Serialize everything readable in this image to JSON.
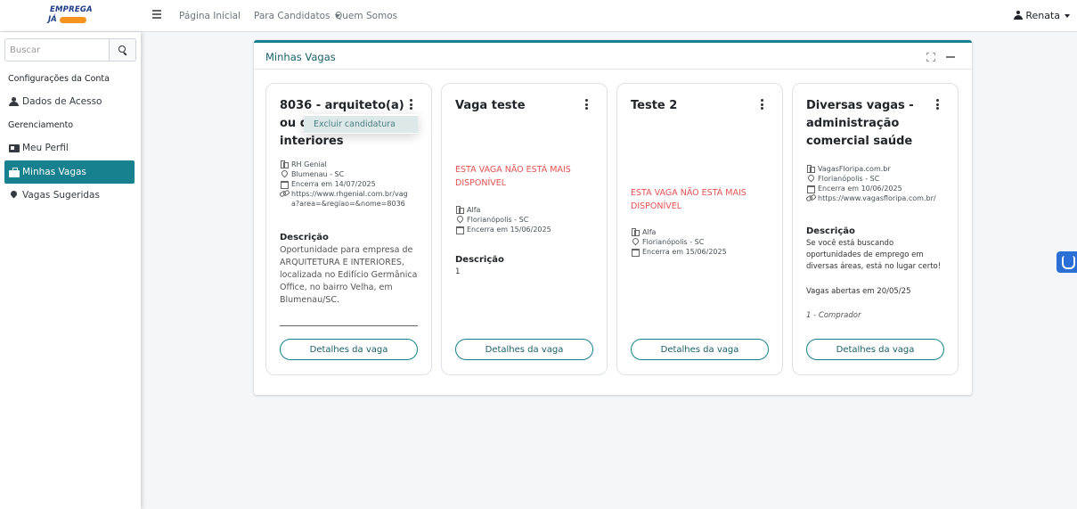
{
  "brand": {
    "line1": "EMPREGA",
    "line2": "JÁ"
  },
  "navbar": {
    "links": [
      "Página Inicial",
      "Para Candidatos",
      "Quem Somos"
    ],
    "user": "Renata"
  },
  "sidebar": {
    "search_placeholder": "Buscar",
    "section1": "Configurações da Conta",
    "item_access": "Dados de Acesso",
    "section2": "Gerenciamento",
    "item_profile": "Meu Perfil",
    "item_jobs": "Minhas Vagas",
    "item_suggested": "Vagas Sugeridas"
  },
  "panel": {
    "title": "Minhas Vagas"
  },
  "dropdown": {
    "item": "Excluir candidatura"
  },
  "cards": [
    {
      "title": "8036 - arquiteto(a) ou de... interiores",
      "title_l1": "8036 - arquiteto(a)",
      "title_l2": "ou de",
      "title_l3": "interiores",
      "company": "RH Genial",
      "location": "Blumenau - SC",
      "ends": "Encerra em 14/07/2025",
      "link": "https://www.rhgenial.com.br/vaga?area=&regiao=&nome=8036",
      "link_l1": "https://www.rhgenial.com.br/vag",
      "link_l2": "a?area=&regiao=&nome=8036",
      "desc_label": "Descrição",
      "desc": "Oportunidade para empresa de ARQUITETURA E INTERIORES, localizada no Edifício Germânica Office, no bairro Velha, em Blumenau/SC.",
      "button": "Detalhes da vaga"
    },
    {
      "title": "Vaga teste",
      "unavailable": "ESTA VAGA NÃO ESTÁ MAIS DISPONÍVEL",
      "company": "Alfa",
      "location": "Florianópolis - SC",
      "ends": "Encerra em 15/06/2025",
      "desc_label": "Descrição",
      "desc": "1",
      "button": "Detalhes da vaga"
    },
    {
      "title": "Teste 2",
      "unavailable": "ESTA VAGA NÃO ESTÁ MAIS DISPONÍVEL",
      "company": "Alfa",
      "location": "Florianópolis - SC",
      "ends": "Encerra em 15/06/2025",
      "button": "Detalhes da vaga"
    },
    {
      "title": "Diversas vagas - administração comercial saúde",
      "company": "VagasFloripa.com.br",
      "location": "Florianópolis - SC",
      "ends": "Encerra em 10/06/2025",
      "link": "https://www.vagasfloripa.com.br/",
      "desc_label": "Descrição",
      "desc": "Se você está buscando oportunidades de emprego em diversas áreas, está no lugar certo!",
      "desc2": "Vagas abertas em 20/05/25",
      "desc3": "1 - Comprador",
      "button": "Detalhes da vaga"
    }
  ],
  "colors": {
    "accent": "#17818f",
    "unavailable": "#e55353",
    "a11y": "#2a6fd6"
  }
}
